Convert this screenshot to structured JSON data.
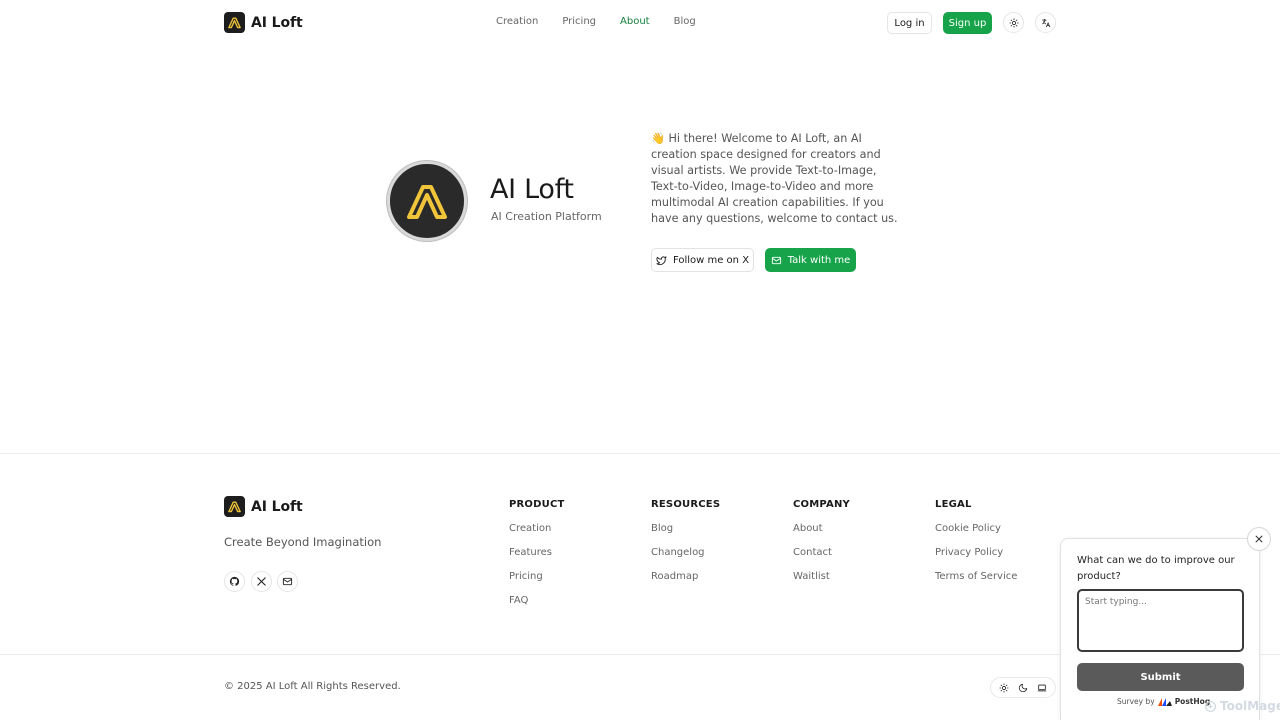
{
  "header": {
    "brand_name": "AI Loft",
    "nav": [
      "Creation",
      "Pricing",
      "About",
      "Blog"
    ],
    "active_nav": "About",
    "login_label": "Log in",
    "signup_label": "Sign up"
  },
  "hero": {
    "title": "AI Loft",
    "subtitle": "AI Creation Platform",
    "description": "👋 Hi there! Welcome to AI Loft, an AI creation space designed for creators and visual artists. We provide Text-to-Image, Text-to-Video, Image-to-Video and more multimodal AI creation capabilities. If you have any questions, welcome to contact us.",
    "follow_label": "Follow me on X",
    "talk_label": "Talk with me"
  },
  "footer": {
    "brand_name": "AI Loft",
    "tagline": "Create Beyond Imagination",
    "columns": [
      {
        "title": "PRODUCT",
        "items": [
          "Creation",
          "Features",
          "Pricing",
          "FAQ"
        ]
      },
      {
        "title": "RESOURCES",
        "items": [
          "Blog",
          "Changelog",
          "Roadmap"
        ]
      },
      {
        "title": "COMPANY",
        "items": [
          "About",
          "Contact",
          "Waitlist"
        ]
      },
      {
        "title": "LEGAL",
        "items": [
          "Cookie Policy",
          "Privacy Policy",
          "Terms of Service"
        ]
      }
    ],
    "copyright": "© 2025 AI Loft All Rights Reserved."
  },
  "survey": {
    "question": "What can we do to improve our product?",
    "placeholder": "Start typing...",
    "submit_label": "Submit",
    "credit_prefix": "Survey by",
    "credit_brand": "PostHog"
  },
  "watermark": "ToolMage",
  "colors": {
    "accent": "#16a34a",
    "accent_text": "#15803d",
    "logo_bg": "#1d1d1d",
    "logo_mark": "#f0c53a"
  }
}
